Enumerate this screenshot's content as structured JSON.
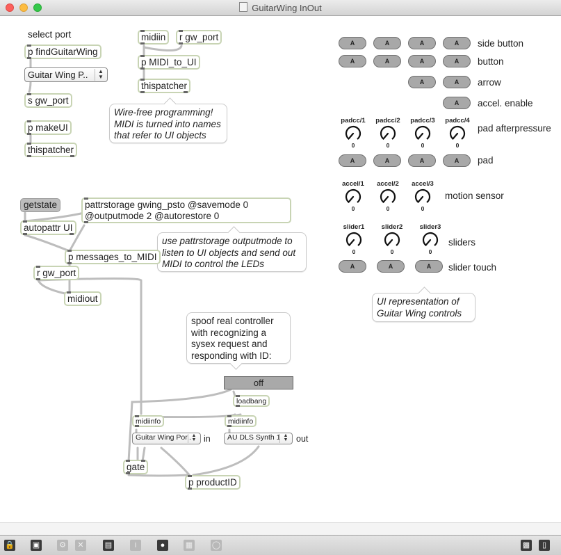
{
  "window": {
    "title": "GuitarWing InOut"
  },
  "patch": {
    "select_port_label": "select port",
    "find_guitarwing": "p findGuitarWing",
    "port_menu": "Guitar Wing P..",
    "s_gw_port": "s gw_port",
    "make_ui": "p makeUI",
    "thispatcher_1": "thispatcher",
    "midiin": "midiin",
    "r_gw_port_1": "r gw_port",
    "midi_to_ui": "p MIDI_to_UI",
    "thispatcher_2": "thispatcher",
    "comment_wirefree": [
      "Wire-free programming!",
      "MIDI is turned into names",
      "that refer to UI objects"
    ],
    "getstate": "getstate",
    "autopattr_ui": "autopattr UI",
    "pattrstorage": [
      "pattrstorage gwing_psto @savemode 0",
      "@outputmode 2 @autorestore 0"
    ],
    "comment_pattr": [
      "use pattrstorage outputmode to",
      "listen to UI objects and send out",
      "MIDI to control the LEDs"
    ],
    "messages_to_midi": "p messages_to_MIDI",
    "r_gw_port_2": "r gw_port",
    "midiout": "midiout",
    "comment_spoof": [
      "spoof real controller",
      "with recognizing a",
      "sysex request and",
      "responding with ID:"
    ],
    "toggle_off": "off",
    "loadbang": "loadbang",
    "midiinfo_1": "midiinfo",
    "midiinfo_2": "midiinfo",
    "in_menu": "Guitar Wing Por..",
    "in_label": "in",
    "out_menu": "AU DLS Synth 1",
    "out_label": "out",
    "gate": "gate",
    "product_id": "p productID"
  },
  "controls": {
    "button_text": "A",
    "labels": {
      "side_button": "side button",
      "button": "button",
      "arrow": "arrow",
      "accel_enable": "accel. enable",
      "pad_afterpressure": "pad afterpressure",
      "pad": "pad",
      "motion_sensor": "motion sensor",
      "sliders": "sliders",
      "slider_touch": "slider touch"
    },
    "padcc": [
      {
        "name": "padcc/1",
        "value": "0"
      },
      {
        "name": "padcc/2",
        "value": "0"
      },
      {
        "name": "padcc/3",
        "value": "0"
      },
      {
        "name": "padcc/4",
        "value": "0"
      }
    ],
    "accel": [
      {
        "name": "accel/1",
        "value": "0"
      },
      {
        "name": "accel/2",
        "value": "0"
      },
      {
        "name": "accel/3",
        "value": "0"
      }
    ],
    "sliders": [
      {
        "name": "slider1",
        "value": "0"
      },
      {
        "name": "slider2",
        "value": "0"
      },
      {
        "name": "slider3",
        "value": "0"
      }
    ],
    "comment_ui": [
      "UI representation of",
      "Guitar Wing controls"
    ]
  },
  "toolbar": {
    "icons": [
      "lock-icon",
      "presentation-icon",
      "debug-icon",
      "clear-icon",
      "inspector-icon",
      "info-icon",
      "patchcord-icon",
      "grid-icon",
      "clue-icon",
      "split-left-icon",
      "split-right-icon"
    ]
  },
  "colors": {
    "object_border": "#c8d4b4",
    "ui_button": "#a8a8a8",
    "toggle": "#a9a9a9"
  }
}
